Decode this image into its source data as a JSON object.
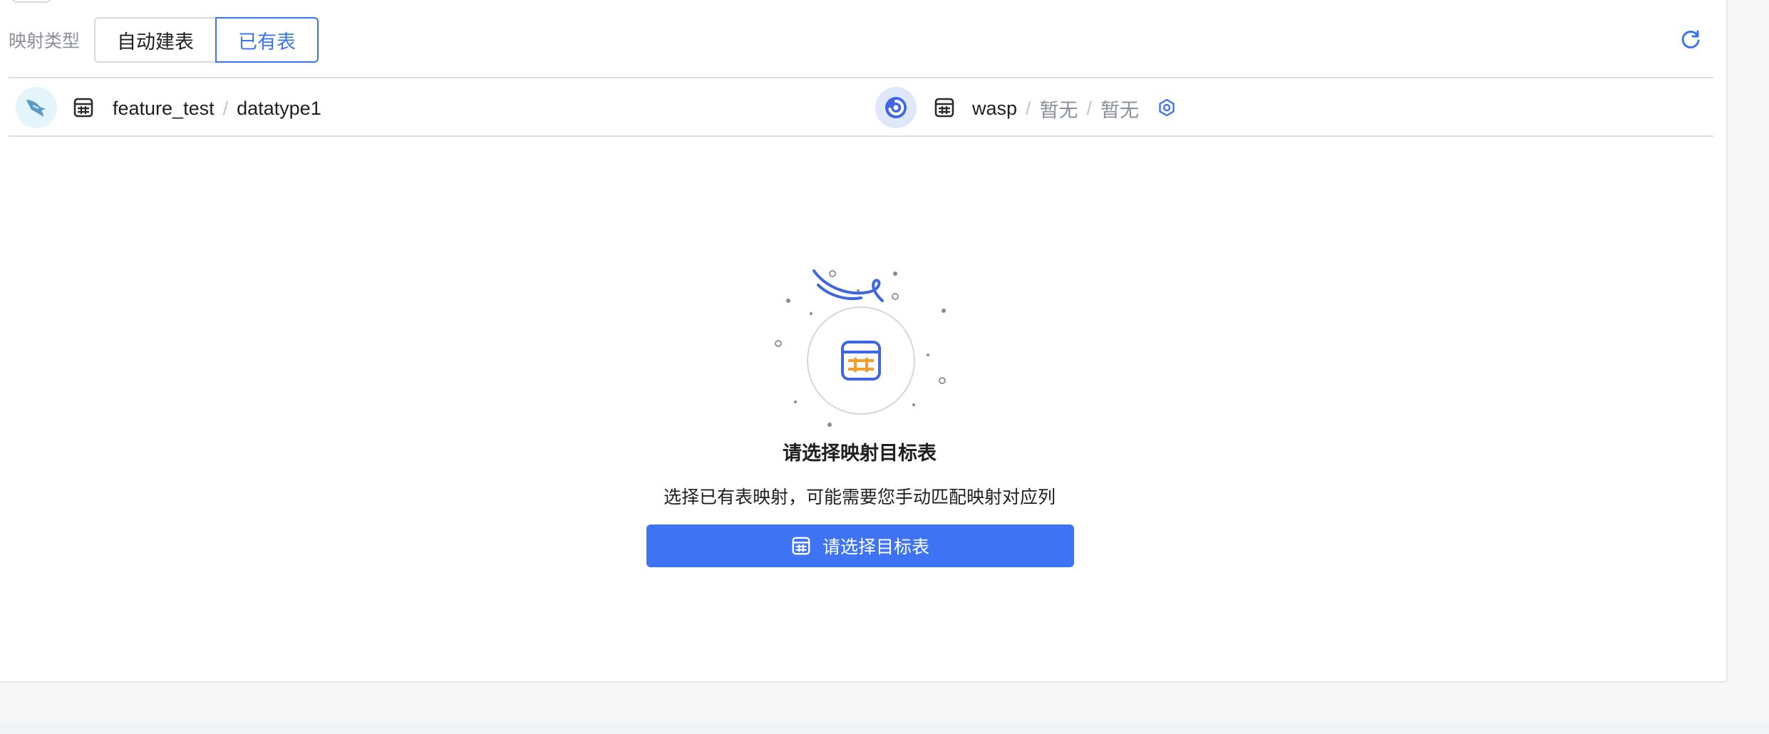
{
  "mapping": {
    "label": "映射类型",
    "options": [
      "自动建表",
      "已有表"
    ],
    "selected": "已有表"
  },
  "source": {
    "db": "feature_test",
    "table": "datatype1",
    "logo_icon": "mysql-dolphin-icon"
  },
  "target": {
    "db": "wasp",
    "schema": "暂无",
    "table": "暂无",
    "logo_icon": "target-db-logo-icon"
  },
  "empty": {
    "title": "请选择映射目标表",
    "description": "选择已有表映射，可能需要您手动匹配映射对应列",
    "button_label": "请选择目标表"
  },
  "colors": {
    "accent": "#3e73f4",
    "orange": "#f0a030"
  }
}
